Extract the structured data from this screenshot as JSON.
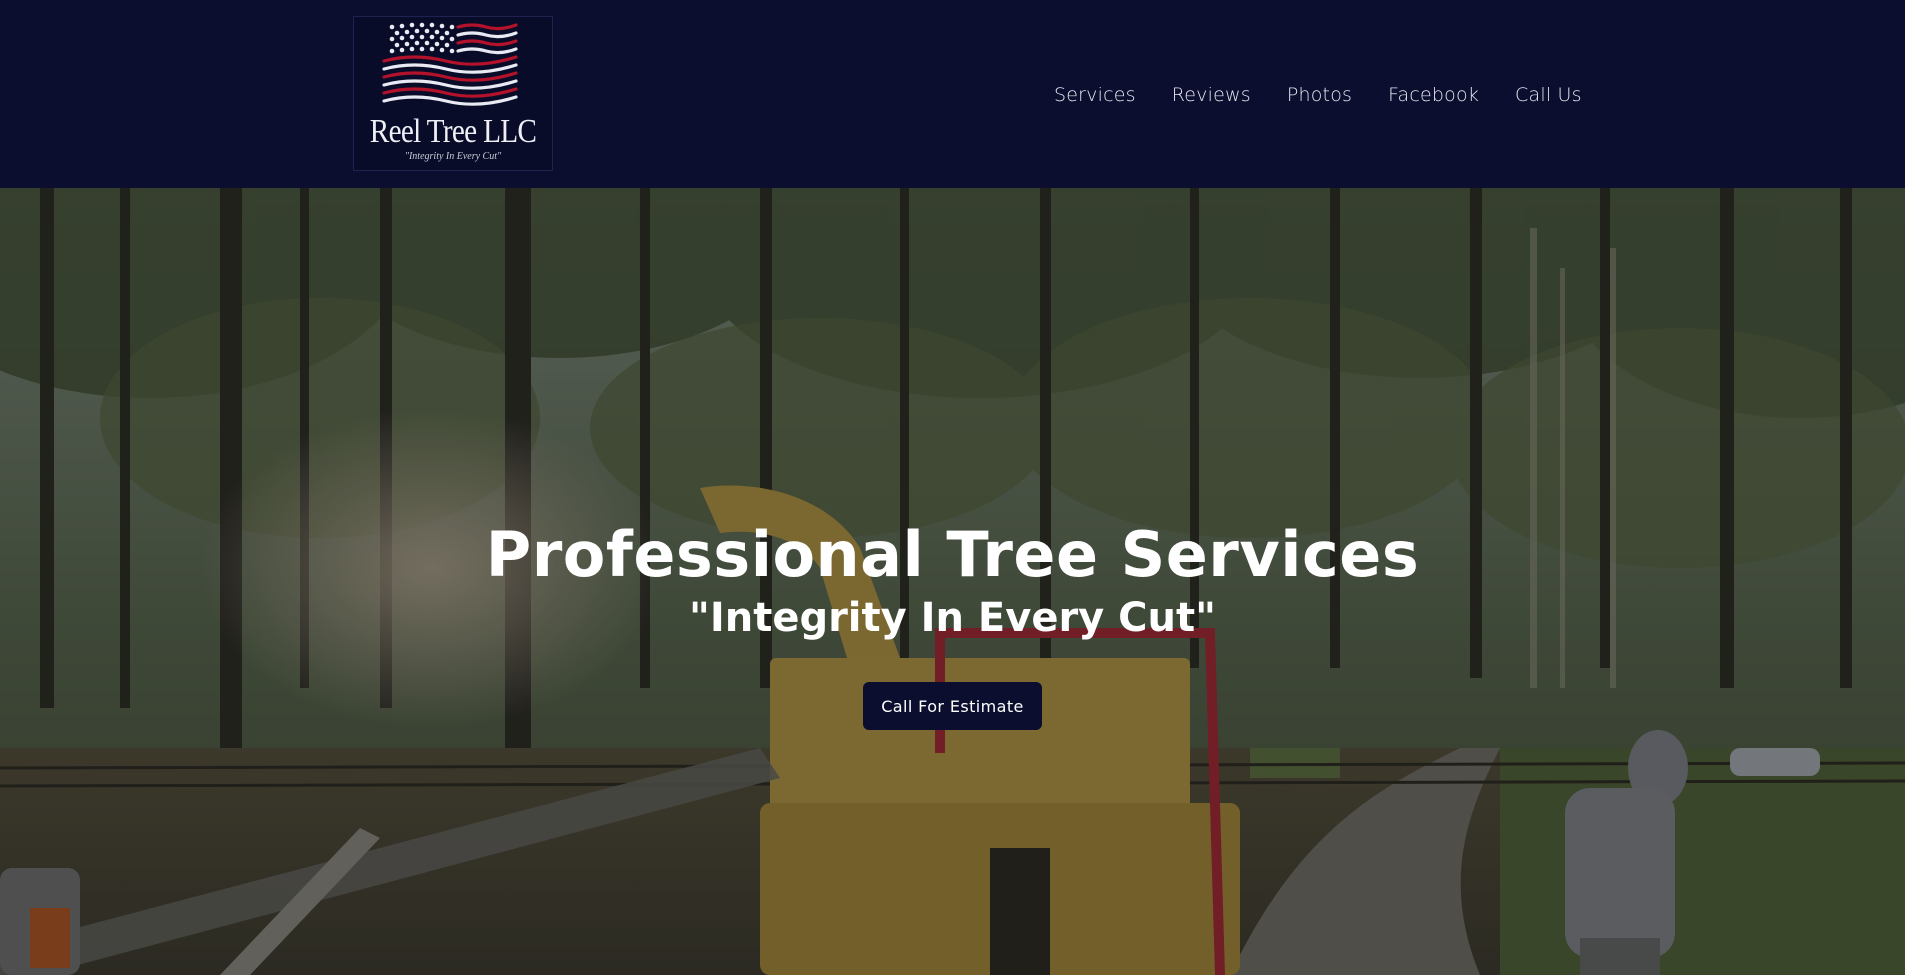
{
  "brand": {
    "name": "Reel Tree LLC",
    "tagline": "\"Integrity In Every Cut\"",
    "colors": {
      "navy": "#0b0e2e",
      "red": "#b3122a",
      "white": "#ffffff"
    }
  },
  "nav": {
    "items": [
      {
        "label": "Services"
      },
      {
        "label": "Reviews"
      },
      {
        "label": "Photos"
      },
      {
        "label": "Facebook"
      },
      {
        "label": "Call Us"
      }
    ]
  },
  "hero": {
    "title": "Professional Tree Services",
    "subtitle": "\"Integrity In Every Cut\"",
    "cta_label": "Call For Estimate"
  }
}
